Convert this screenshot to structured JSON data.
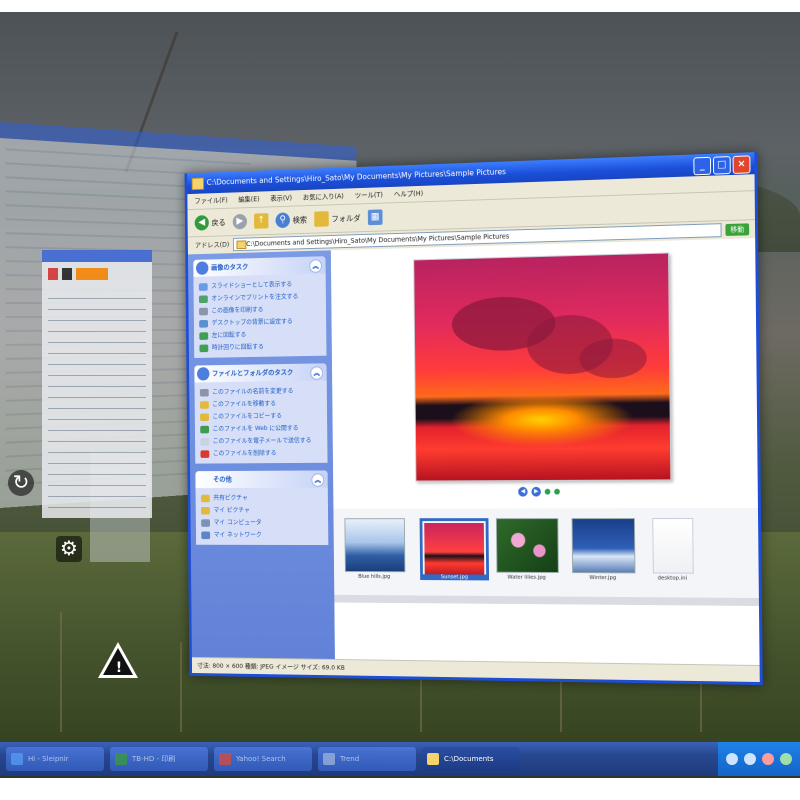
{
  "window": {
    "title": "C:\\Documents and Settings\\Hiro_Sato\\My Documents\\My Pictures\\Sample Pictures",
    "menus": [
      "ファイル(F)",
      "編集(E)",
      "表示(V)",
      "お気に入り(A)",
      "ツール(T)",
      "ヘルプ(H)"
    ],
    "toolbar": {
      "back": "戻る",
      "search": "検索",
      "folders": "フォルダ"
    },
    "address_label": "アドレス(D)",
    "address": "C:\\Documents and Settings\\Hiro_Sato\\My Documents\\My Pictures\\Sample Pictures",
    "go": "移動"
  },
  "taskpane": {
    "panels": [
      {
        "title": "画像のタスク",
        "items": [
          "スライドショーとして表示する",
          "オンラインでプリントを注文する",
          "この画像を印刷する",
          "デスクトップの背景に設定する",
          "左に回転する",
          "時計回りに回転する"
        ]
      },
      {
        "title": "ファイルとフォルダのタスク",
        "items": [
          "このファイルの名前を変更する",
          "このファイルを移動する",
          "このファイルをコピーする",
          "このファイルを Web に公開する",
          "このファイルを電子メールで送信する",
          "このファイルを削除する"
        ]
      },
      {
        "title": "その他",
        "items": [
          "共有ピクチャ",
          "マイ ピクチャ",
          "マイ コンピュータ",
          "マイ ネットワーク"
        ]
      }
    ]
  },
  "filmstrip": {
    "thumbs": [
      {
        "label": "Blue hills.jpg",
        "selected": false
      },
      {
        "label": "Sunset.jpg",
        "selected": true
      },
      {
        "label": "Water lilies.jpg",
        "selected": false
      },
      {
        "label": "Winter.jpg",
        "selected": false
      },
      {
        "label": "desktop.ini",
        "selected": false
      }
    ]
  },
  "status": "寸法: 800 × 600   種類: JPEG イメージ   サイズ: 69.0 KB",
  "taskbar": {
    "buttons": [
      {
        "label": "Hi - Sleipnir",
        "active": false
      },
      {
        "label": "TB-HD - 印刷",
        "active": false
      },
      {
        "label": "Yahoo! Search",
        "active": false
      },
      {
        "label": "Trend",
        "active": false
      },
      {
        "label": "C:\\Documents",
        "active": true
      }
    ]
  },
  "colors": {
    "title_blue": "#1b4fd8",
    "taskpane_blue": "#6282d8",
    "link_blue": "#215dc6",
    "selection_blue": "#316ac5"
  }
}
